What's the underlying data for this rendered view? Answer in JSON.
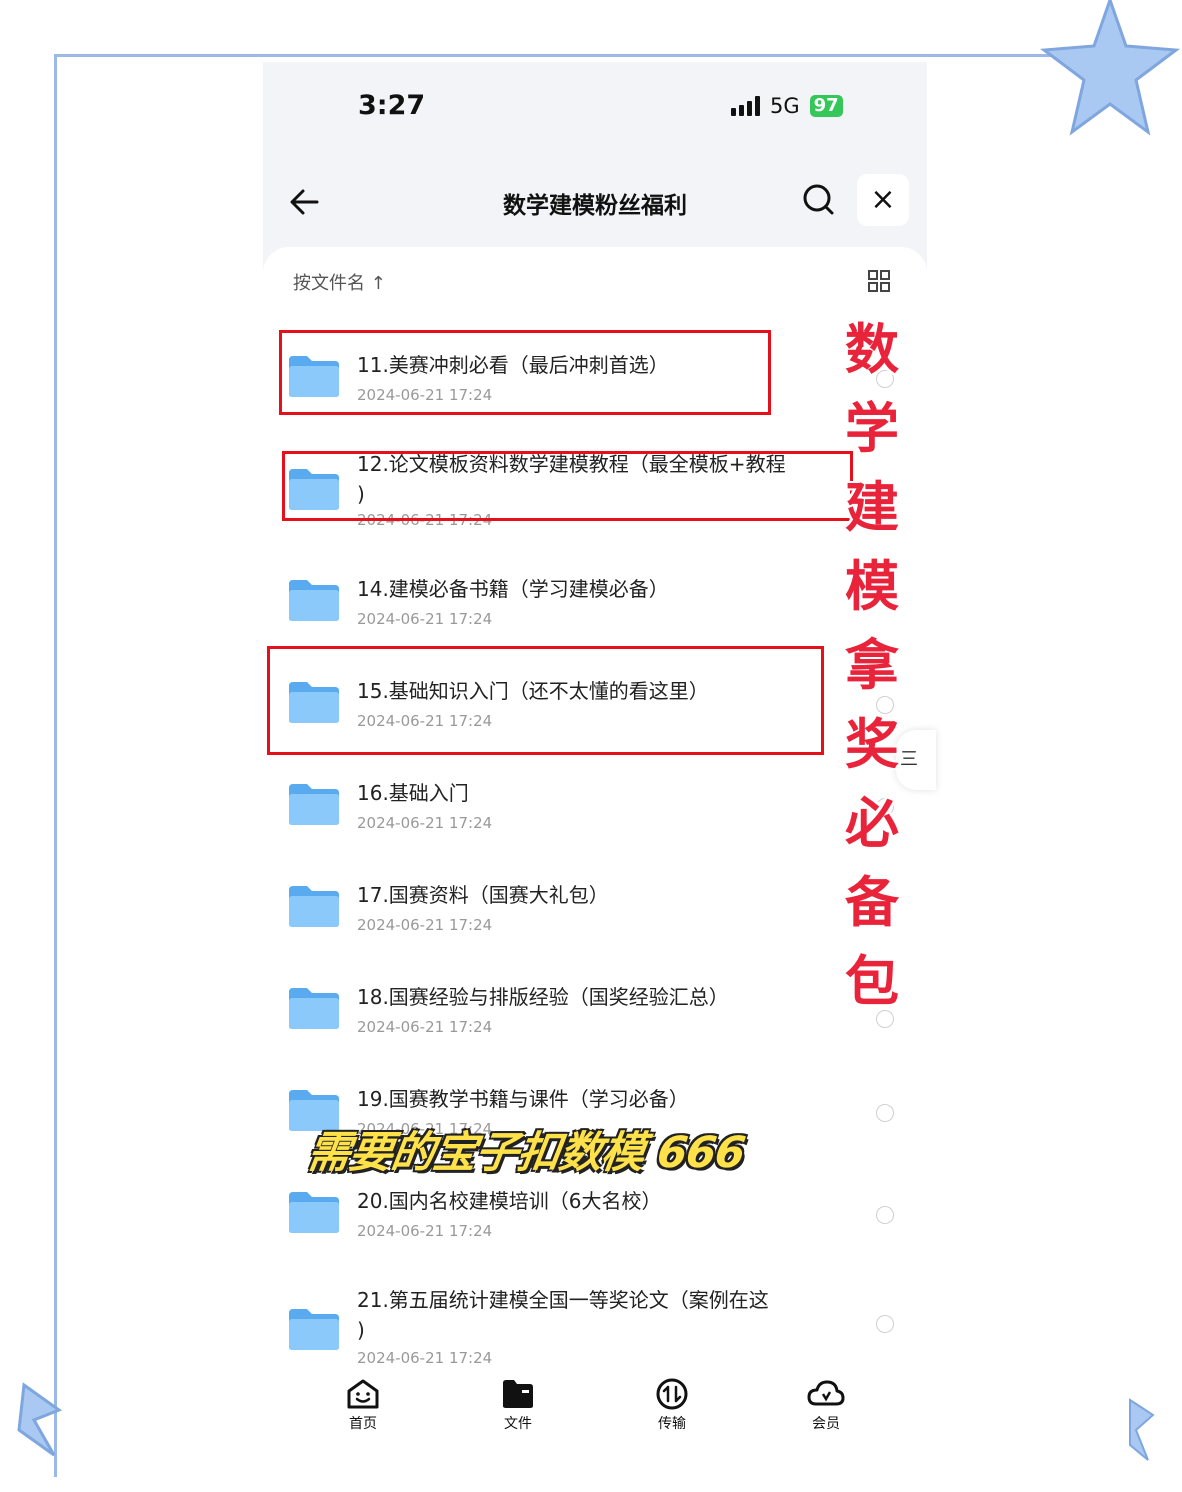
{
  "status_bar": {
    "time": "3:27",
    "network": "5G",
    "battery": "97"
  },
  "nav": {
    "title": "数学建模粉丝福利",
    "back_icon": "arrow-left-icon",
    "search_icon": "search-icon",
    "close_label": "×"
  },
  "sort": {
    "label": "按文件名 ↑",
    "view_icon": "grid-view-icon"
  },
  "files": [
    {
      "name": "11.美赛冲刺必看（最后冲刺首选）",
      "date": "2024-06-21 17:24"
    },
    {
      "name_line1": "12.论文模板资料数学建模教程（最全模板+教程",
      "name_line2": ")",
      "date": "2024-06-21 17:24"
    },
    {
      "name": "14.建模必备书籍（学习建模必备）",
      "date": "2024-06-21 17:24"
    },
    {
      "name": "15.基础知识入门（还不太懂的看这里）",
      "date": "2024-06-21 17:24"
    },
    {
      "name": "16.基础入门",
      "date": "2024-06-21 17:24"
    },
    {
      "name": "17.国赛资料（国赛大礼包）",
      "date": "2024-06-21 17:24"
    },
    {
      "name": "18.国赛经验与排版经验（国奖经验汇总）",
      "date": "2024-06-21 17:24"
    },
    {
      "name": "19.国赛教学书籍与课件（学习必备）",
      "date": "2024-06-21 17:24"
    },
    {
      "name": "20.国内名校建模培训（6大名校）",
      "date": "2024-06-21 17:24"
    },
    {
      "name_line1": "21.第五届统计建模全国一等奖论文（案例在这",
      "name_line2": ")",
      "date": "2024-06-21 17:24"
    }
  ],
  "overlay": {
    "side_text": [
      "数",
      "学",
      "建",
      "模",
      "拿",
      "奖",
      "必",
      "备",
      "包"
    ],
    "caption": "需要的宝子扣数模 666",
    "accent_red": "#e5101a",
    "caption_color": "#ffe24a"
  },
  "edge_button": {
    "label": "三"
  },
  "tabbar": [
    {
      "label": "首页",
      "icon": "home-smile-icon"
    },
    {
      "label": "文件",
      "icon": "folder-icon"
    },
    {
      "label": "传输",
      "icon": "transfer-icon"
    },
    {
      "label": "会员",
      "icon": "cloud-icon"
    }
  ]
}
